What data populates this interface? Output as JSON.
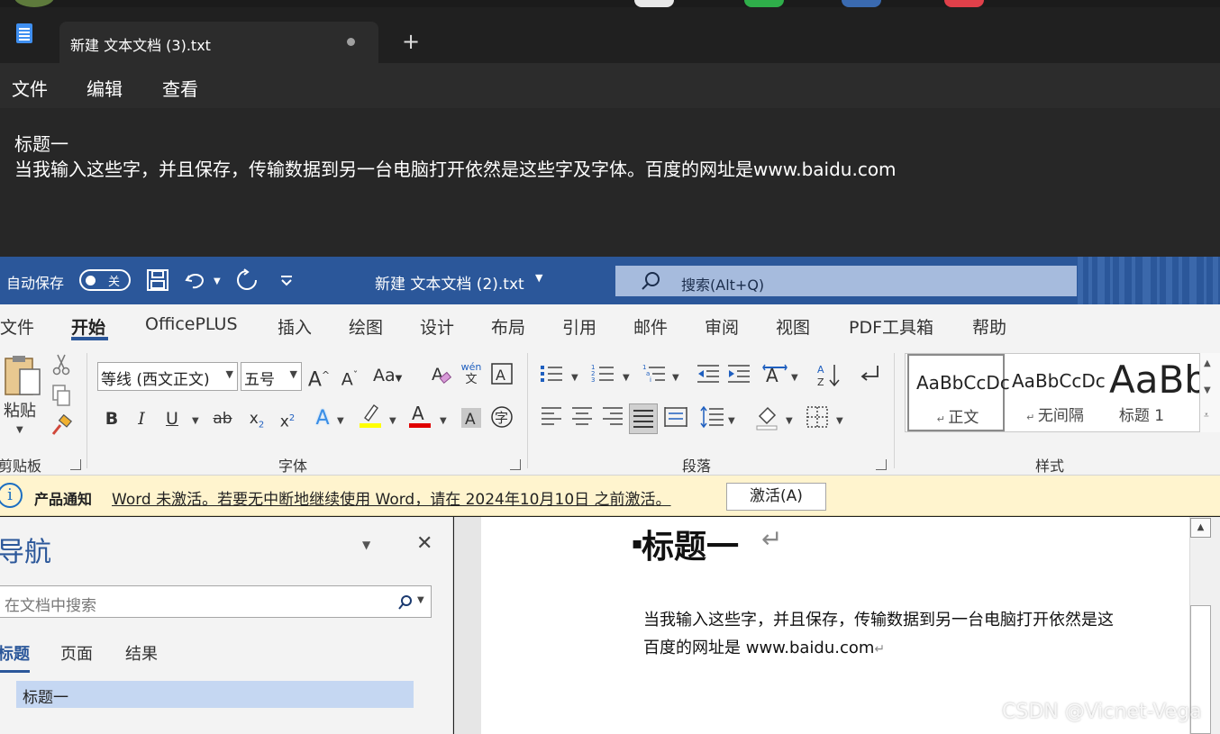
{
  "notepad": {
    "tab_title": "新建 文本文档 (3).txt",
    "new_tab": "+",
    "menu": [
      "文件",
      "编辑",
      "查看"
    ],
    "lines": [
      "标题一",
      "当我输入这些字，并且保存，传输数据到另一台电脑打开依然是这些字及字体。百度的网址是www.baidu.com"
    ]
  },
  "word": {
    "autosave_label": "自动保存",
    "autosave_state": "关",
    "doc_title": "新建 文本文档 (2).txt",
    "search_placeholder": "搜索(Alt+Q)",
    "tabs": [
      "文件",
      "开始",
      "OfficePLUS",
      "插入",
      "绘图",
      "设计",
      "布局",
      "引用",
      "邮件",
      "审阅",
      "视图",
      "PDF工具箱",
      "帮助"
    ],
    "active_tab": "开始",
    "ribbon": {
      "clipboard": {
        "paste_label": "粘贴",
        "group_label": "剪贴板"
      },
      "font": {
        "font_name": "等线 (西文正文)",
        "font_size": "五号",
        "group_label": "字体",
        "phonetic": "wén",
        "phonetic_char": "文"
      },
      "paragraph": {
        "group_label": "段落"
      },
      "styles": {
        "group_label": "样式",
        "items": [
          {
            "sample": "AaBbCcDc",
            "name": "正文"
          },
          {
            "sample": "AaBbCcDc",
            "name": "无间隔"
          },
          {
            "sample": "AaBb",
            "name": "标题 1"
          }
        ]
      }
    },
    "notification": {
      "title": "产品通知",
      "message": "Word 未激活。若要无中断地继续使用 Word，请在 2024年10月10日 之前激活。",
      "button": "激活(A)"
    },
    "nav": {
      "title": "导航",
      "search_placeholder": "在文档中搜索",
      "tabs": [
        "标题",
        "页面",
        "结果"
      ],
      "headings": [
        "标题一"
      ]
    },
    "document": {
      "heading": "标题一",
      "line1": "当我输入这些字，并且保存，传输数据到另一台电脑打开依然是这",
      "line2": "百度的网址是 www.baidu.com"
    }
  },
  "watermark": "CSDN @Vicnet-Vega",
  "colors": {
    "word_blue": "#2b579a",
    "notepad_bg": "#272727",
    "notice_bg": "#fff4ce"
  }
}
